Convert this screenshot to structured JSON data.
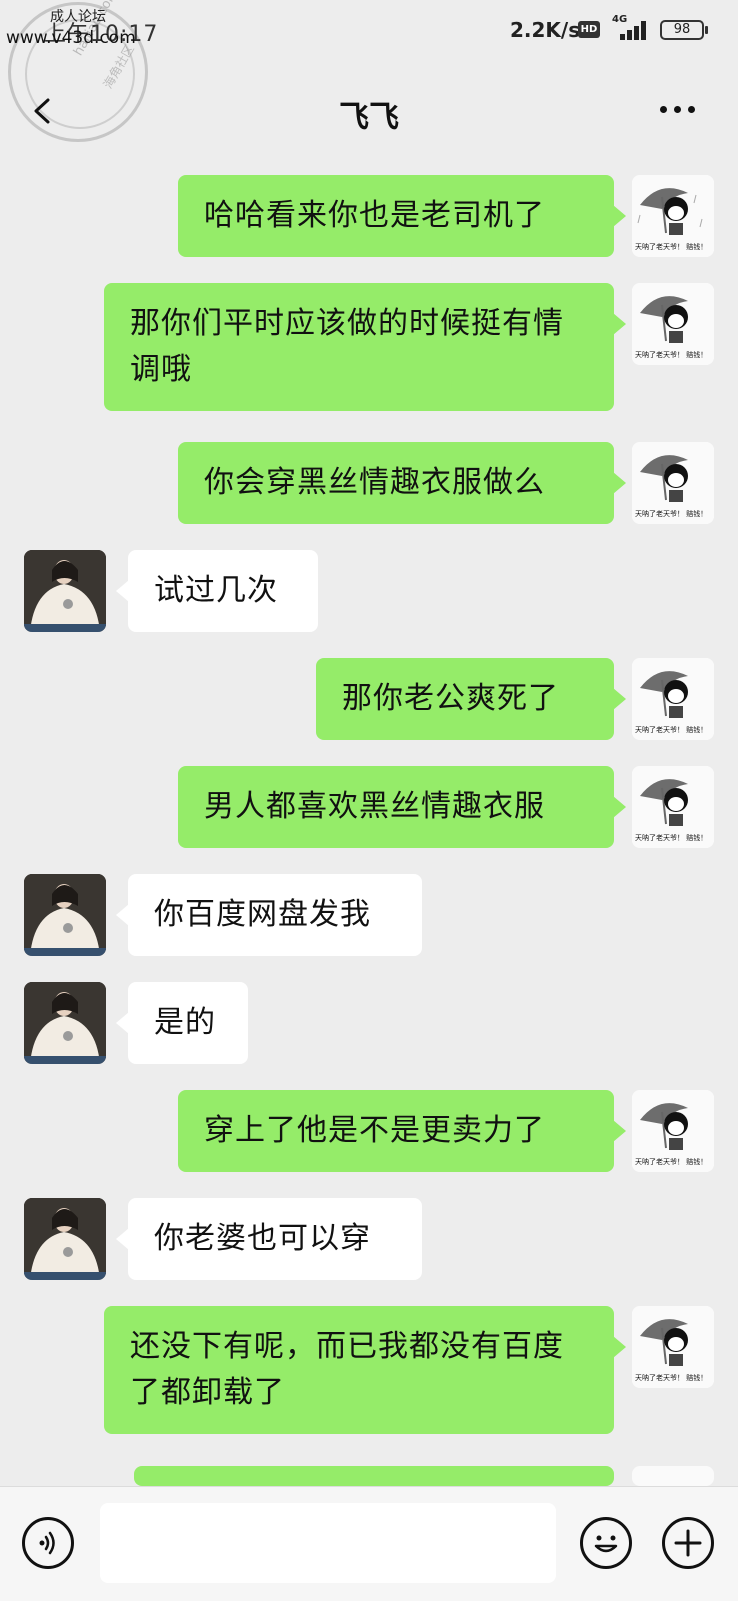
{
  "status_bar": {
    "time": "上午10:17",
    "watermark_top": "成人论坛",
    "watermark_url": "www.v43d.com",
    "watermark_stamp": "haijiao.com",
    "watermark_stamp2": "海角社区",
    "net_speed": "2.2K/s",
    "hd_label": "HD",
    "net_type": "4G",
    "battery": "98"
  },
  "header": {
    "title": "飞飞",
    "back_icon": "back-arrow-icon",
    "more_icon": "more-dots-icon"
  },
  "avatar_caption": "天呐了老天爷！ 赔钱！",
  "messages": [
    {
      "side": "sent",
      "text": "哈哈看来你也是老司机了"
    },
    {
      "side": "sent",
      "text": "那你们平时应该做的时候挺有情调哦"
    },
    {
      "side": "sent",
      "text": "你会穿黑丝情趣衣服做么"
    },
    {
      "side": "received",
      "text": "试过几次"
    },
    {
      "side": "sent",
      "text": "那你老公爽死了"
    },
    {
      "side": "sent",
      "text": "男人都喜欢黑丝情趣衣服"
    },
    {
      "side": "received",
      "text": "你百度网盘发我"
    },
    {
      "side": "received",
      "text": "是的"
    },
    {
      "side": "sent",
      "text": "穿上了他是不是更卖力了"
    },
    {
      "side": "received",
      "text": "你老婆也可以穿"
    },
    {
      "side": "sent",
      "text": "还没下有呢，而已我都没有百度了都卸载了"
    },
    {
      "side": "sent",
      "text": ""
    }
  ],
  "input_bar": {
    "voice_icon": "voice-icon",
    "input_value": "",
    "emoji_icon": "emoji-icon",
    "plus_icon": "plus-icon"
  },
  "colors": {
    "background": "#ededed",
    "sent_bubble": "#95ec69",
    "received_bubble": "#ffffff"
  }
}
